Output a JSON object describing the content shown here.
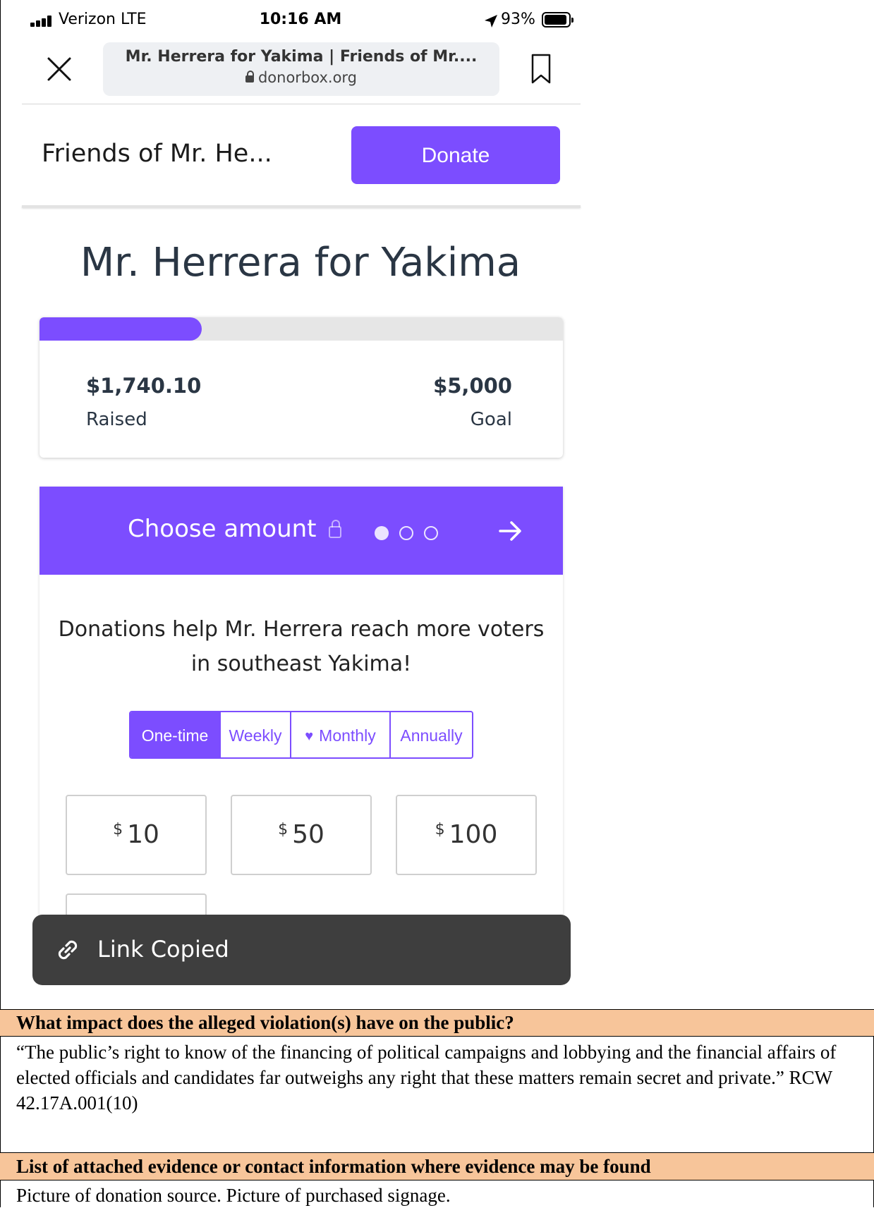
{
  "status_bar": {
    "carrier": "Verizon  LTE",
    "time": "10:16 AM",
    "battery": "93%"
  },
  "browser": {
    "page_title": "Mr. Herrera for Yakima | Friends of Mr....",
    "domain": "donorbox.org",
    "icons": [
      "close-icon",
      "lock-icon",
      "bookmark-icon"
    ]
  },
  "site": {
    "name": "Friends of Mr. He...",
    "donate_label": "Donate",
    "accent_color": "#7c4dff"
  },
  "campaign": {
    "title": "Mr. Herrera for Yakima",
    "raised_value": "$1,740.10",
    "raised_label": "Raised",
    "goal_value": "$5,000",
    "goal_label": "Goal",
    "progress_fraction": 0.31
  },
  "donation_form": {
    "step_label": "Choose amount",
    "step_count": 3,
    "current_step": 1,
    "message": "Donations help Mr. Herrera reach more voters in southeast Yakima!",
    "frequencies": [
      {
        "label": "One-time",
        "active": true
      },
      {
        "label": "Weekly",
        "active": false
      },
      {
        "label": "Monthly",
        "active": false,
        "icon": "heart-icon"
      },
      {
        "label": "Annually",
        "active": false
      }
    ],
    "currency_symbol": "$",
    "amounts": [
      "10",
      "50",
      "100"
    ]
  },
  "toast": {
    "text": "Link Copied",
    "icon": "link-icon"
  },
  "document": {
    "impact_heading": "What impact does the alleged violation(s) have on the public?",
    "impact_text": "“The public’s right to know of the financing of political campaigns and lobbying and the financial affairs of elected officials and candidates far outweighs any right that these matters remain secret and private.” RCW 42.17A.001(10)",
    "evidence_heading": "List of attached evidence or contact information where evidence may be found",
    "evidence_text": "Picture of donation source. Picture of purchased signage.",
    "heading_color": "#f7c59a"
  }
}
